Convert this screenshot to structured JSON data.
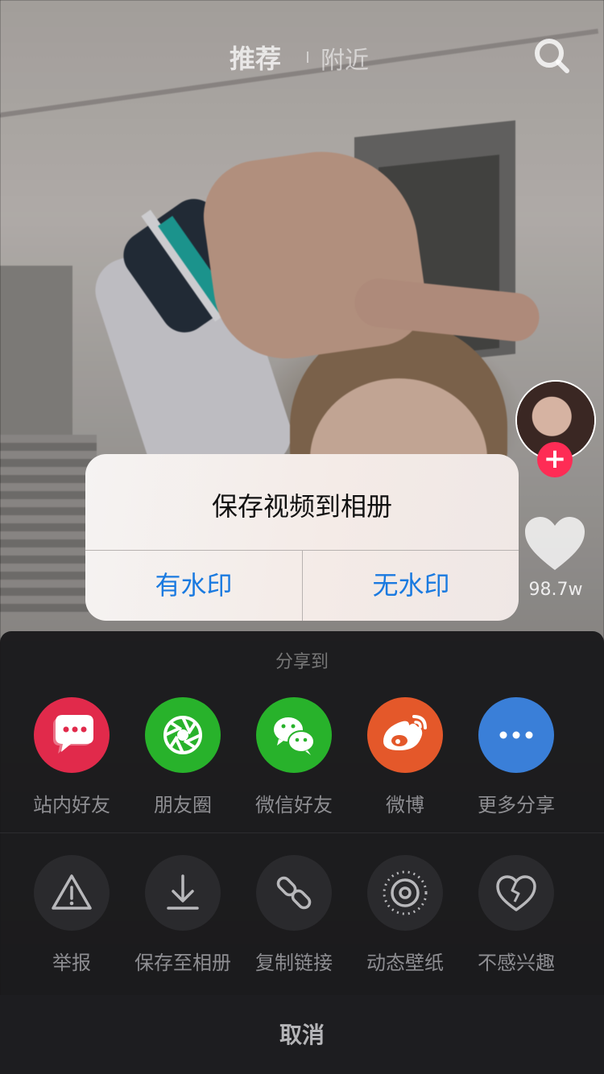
{
  "topnav": {
    "tab_recommend": "推荐",
    "tab_nearby": "附近",
    "search_icon": "search-icon"
  },
  "sidebar": {
    "avatar_icon": "avatar",
    "follow_label": "+",
    "like_icon": "heart-icon",
    "like_count": "98.7w"
  },
  "alert": {
    "title": "保存视频到相册",
    "btn_with_watermark": "有水印",
    "btn_no_watermark": "无水印",
    "button_color": "#1a7ae0"
  },
  "share_sheet": {
    "title": "分享到",
    "share_items": [
      {
        "label": "站内好友",
        "icon": "chat-bubble-icon",
        "color": "#e12a4b"
      },
      {
        "label": "朋友圈",
        "icon": "moments-aperture-icon",
        "color": "#28b22b"
      },
      {
        "label": "微信好友",
        "icon": "wechat-icon",
        "color": "#28b22b"
      },
      {
        "label": "微博",
        "icon": "weibo-icon",
        "color": "#e4582a"
      },
      {
        "label": "更多分享",
        "icon": "more-dots-icon",
        "color": "#3a7fd8"
      }
    ],
    "action_items": [
      {
        "label": "举报",
        "icon": "warning-icon"
      },
      {
        "label": "保存至相册",
        "icon": "download-icon"
      },
      {
        "label": "复制链接",
        "icon": "link-icon"
      },
      {
        "label": "动态壁纸",
        "icon": "live-wallpaper-icon"
      },
      {
        "label": "不感兴趣",
        "icon": "broken-heart-icon"
      }
    ],
    "cancel_label": "取消"
  }
}
